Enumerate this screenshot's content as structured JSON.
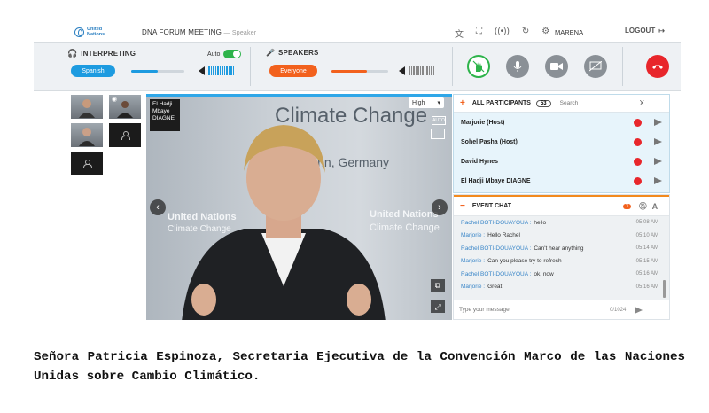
{
  "header": {
    "logo_text": "United Nations",
    "meeting_title": "DNA FORUM MEETING",
    "role": "— Speaker",
    "username": "MARENA",
    "logout_label": "LOGOUT"
  },
  "controls": {
    "interpreting_label": "INTERPRETING",
    "interpreting_language": "Spanish",
    "auto_label": "Auto",
    "auto_enabled": true,
    "interpreting_level": 0.5,
    "speakers_label": "SPEAKERS",
    "speakers_channel": "Everyone",
    "speakers_level": 0.62,
    "colors": {
      "blue": "#1d9be0",
      "orange": "#f2611d",
      "green": "#2db34a",
      "red": "#e8262b"
    }
  },
  "video": {
    "speaker_name": "El Hadji Mbaye DIAGNE",
    "quality": "High",
    "backdrop_text_1": "Climate Change",
    "backdrop_text_2": "Bonn, Germany",
    "backdrop_un_1": "United Nations",
    "backdrop_un_2": "Climate Change",
    "backdrop_un_3": "United Nations",
    "backdrop_un_4": "Climate Change"
  },
  "participants": {
    "header": "ALL PARTICIPANTS",
    "count": "53",
    "search_placeholder": "Search",
    "close": "X",
    "list": [
      {
        "name": "Marjorie (Host)"
      },
      {
        "name": "Sohel Pasha (Host)"
      },
      {
        "name": "David Hynes"
      },
      {
        "name": "El Hadji Mbaye DIAGNE"
      }
    ]
  },
  "chat": {
    "header": "EVENT CHAT",
    "unread": "1",
    "messages": [
      {
        "sender": "Rachel BOTI-DOUAYOUA :",
        "text": "hello",
        "time": "05:08 AM"
      },
      {
        "sender": "Marjorie :",
        "text": "Hello Rachel",
        "time": "05:10 AM"
      },
      {
        "sender": "Rachel BOTI-DOUAYOUA :",
        "text": "Can't hear anything",
        "time": "05:14 AM"
      },
      {
        "sender": "Marjorie :",
        "text": "Can you please try to refresh",
        "time": "05:15 AM"
      },
      {
        "sender": "Rachel BOTI-DOUAYOUA :",
        "text": "ok, now",
        "time": "05:16 AM"
      },
      {
        "sender": "Marjorie :",
        "text": "Great",
        "time": "05:16 AM"
      }
    ],
    "input_placeholder": "Type your message",
    "char_count": "0/1024"
  },
  "caption": "Señora Patricia Espinoza, Secretaria Ejecutiva de la Convención Marco de las Naciones Unidas sobre Cambio Climático."
}
